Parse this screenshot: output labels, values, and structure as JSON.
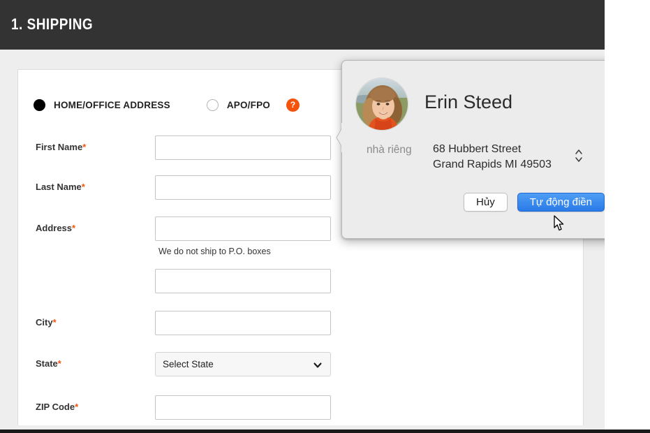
{
  "section": {
    "title": "1. SHIPPING"
  },
  "address_type": {
    "options": [
      {
        "label": "HOME/OFFICE ADDRESS",
        "selected": true
      },
      {
        "label": "APO/FPO",
        "selected": false
      }
    ],
    "help_icon": "help-question-icon",
    "help_glyph": "?"
  },
  "form": {
    "required_marker": "*",
    "fields": [
      {
        "label": "First Name",
        "required": true,
        "value": "",
        "placeholder": ""
      },
      {
        "label": "Last Name",
        "required": true,
        "value": "",
        "placeholder": ""
      },
      {
        "label": "Address",
        "required": true,
        "value": "",
        "placeholder": ""
      },
      {
        "label": "",
        "required": false,
        "value": "",
        "placeholder": ""
      },
      {
        "label": "City",
        "required": true,
        "value": "",
        "placeholder": ""
      },
      {
        "label": "ZIP Code",
        "required": true,
        "value": "",
        "placeholder": ""
      }
    ],
    "address_helper_text": "We do not ship to P.O. boxes",
    "state": {
      "label": "State",
      "required": true,
      "selected": "Select State",
      "chevron_icon": "chevron-down-icon"
    }
  },
  "autofill_popover": {
    "avatar_icon": "contact-avatar",
    "contact_name": "Erin Steed",
    "address_kind": "nhà riêng",
    "address_line1": "68 Hubbert Street",
    "address_line2": "Grand Rapids MI 49503",
    "stepper_icon": "up-down-stepper-icon",
    "cancel_label": "Hủy",
    "autofill_label": "Tự động điền"
  },
  "cursor": {
    "icon": "mouse-pointer-icon"
  },
  "colors": {
    "header_bg": "#333333",
    "page_bg": "#eeeeee",
    "card_bg": "#ffffff",
    "accent_orange": "#f4530c",
    "primary_blue": "#2a7ae8",
    "popover_bg": "#ececec"
  }
}
